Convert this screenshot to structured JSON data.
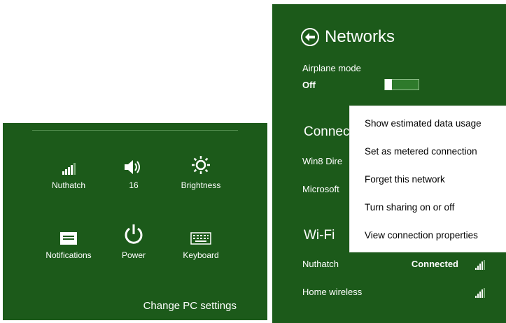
{
  "settings_panel": {
    "tiles": [
      {
        "label": "Nuthatch",
        "icon": "wifi-signal-icon"
      },
      {
        "label": "16",
        "icon": "volume-icon"
      },
      {
        "label": "Brightness",
        "icon": "brightness-icon"
      },
      {
        "label": "Notifications",
        "icon": "notifications-icon"
      },
      {
        "label": "Power",
        "icon": "power-icon"
      },
      {
        "label": "Keyboard",
        "icon": "keyboard-icon"
      }
    ],
    "change_pc_settings": "Change PC settings"
  },
  "networks": {
    "title": "Networks",
    "airplane_mode_label": "Airplane mode",
    "airplane_mode_state": "Off",
    "connections_heading": "Connec",
    "connections": [
      {
        "name": "Win8 Dire"
      },
      {
        "name": "Microsoft"
      }
    ],
    "wifi_heading": "Wi-Fi",
    "wifi": [
      {
        "name": "Nuthatch",
        "status": "Connected"
      },
      {
        "name": "Home wireless",
        "status": ""
      }
    ]
  },
  "context_menu": {
    "items": [
      "Show estimated data usage",
      "Set as metered connection",
      "Forget this network",
      "Turn sharing on or off",
      "View connection properties"
    ]
  },
  "colors": {
    "panel_green": "#1c5a1a",
    "menu_background": "#ffffff"
  }
}
